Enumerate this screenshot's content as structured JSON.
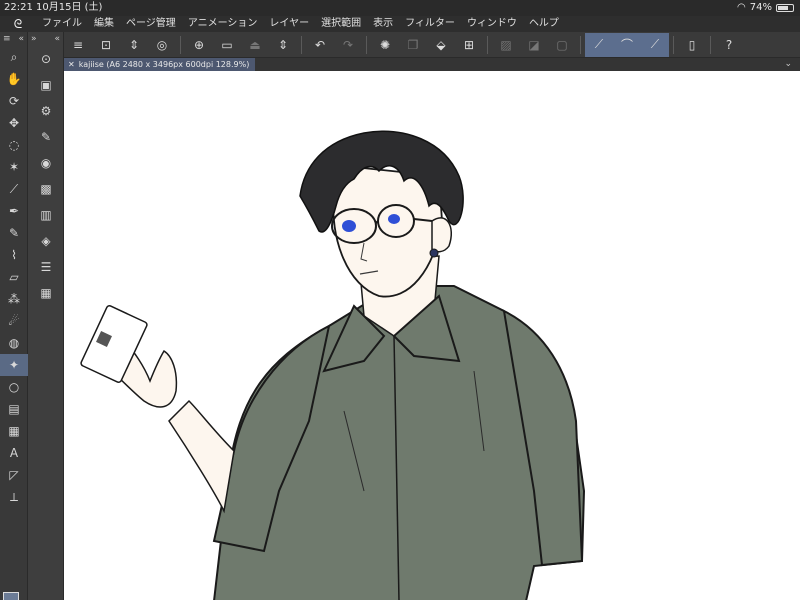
{
  "status": {
    "time": "22:21",
    "date": "10月15日 (土)",
    "battery": "74%",
    "battery_level": 0.74
  },
  "menu": {
    "items": [
      "ファイル",
      "編集",
      "ページ管理",
      "アニメーション",
      "レイヤー",
      "選択範囲",
      "表示",
      "フィルター",
      "ウィンドウ",
      "ヘルプ"
    ]
  },
  "tab": {
    "title": "kajiise (A6 2480 x 3496px 600dpi 128.9%)"
  },
  "colors": {
    "main": "#6c7c96",
    "sub": "#c8beb8",
    "accent": "#5c6e8e"
  },
  "icons": {
    "tools": [
      "zoom-icon",
      "hand-icon",
      "rotate-icon",
      "move-icon",
      "lasso-icon",
      "magic-wand-icon",
      "eyedropper-icon",
      "pen-icon",
      "pencil-icon",
      "brush-icon",
      "eraser-icon",
      "airbrush-icon",
      "blend-icon",
      "fill-icon",
      "decoration-icon",
      "figure-icon",
      "gradient-icon",
      "frame-icon",
      "text-icon",
      "balloon-icon",
      "ruler-icon"
    ],
    "commands": [
      "menu-icon",
      "new-icon",
      "arrows-icon",
      "spiral-icon",
      "import-icon",
      "open-icon",
      "save-icon",
      "arrows-icon",
      "undo-icon",
      "redo-icon",
      "loading-icon",
      "layer-icon",
      "fill-bucket-icon",
      "transform-icon",
      "hide-icon",
      "half-icon",
      "square-icon",
      "snap-line-icon",
      "snap-curve-icon",
      "snap-special-icon",
      "device-icon",
      "help-icon"
    ]
  }
}
